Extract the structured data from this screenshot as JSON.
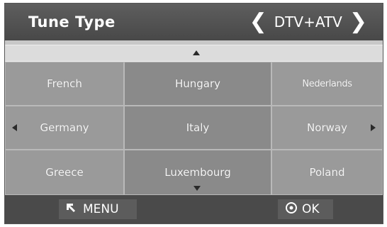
{
  "header": {
    "title": "Tune Type",
    "value": "DTV+ATV"
  },
  "countries": [
    [
      "French",
      "Hungary",
      "Nederlands"
    ],
    [
      "Germany",
      "Italy",
      "Norway"
    ],
    [
      "Greece",
      "Luxembourg",
      "Poland"
    ]
  ],
  "footer": {
    "menu_label": "MENU",
    "ok_label": "OK"
  },
  "icons": {
    "left_chevron": "chevron-left-icon",
    "right_chevron": "chevron-right-icon",
    "scroll_up": "triangle-up-icon",
    "scroll_down": "triangle-down-icon",
    "page_left": "triangle-left-icon",
    "page_right": "triangle-right-icon",
    "menu": "return-arrow-icon",
    "ok": "ok-circle-icon"
  },
  "colors": {
    "header_bg": "#484848",
    "cell_bg": "#9a9a9a",
    "cell_mid_bg": "#8a8a8a",
    "footer_bg": "#4a4a4a",
    "text": "#ffffff"
  }
}
